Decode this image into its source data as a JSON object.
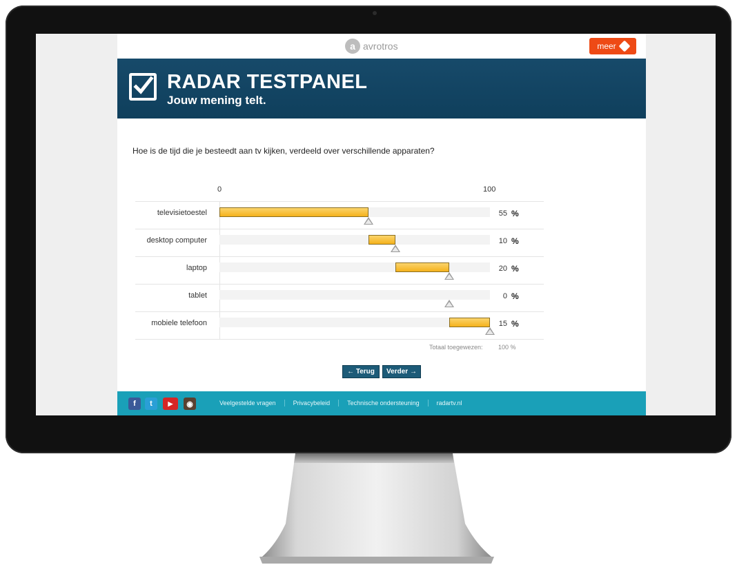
{
  "header": {
    "brand_mark": "a",
    "brand": "avrotros",
    "meer_label": "meer"
  },
  "banner": {
    "title": "RADAR TESTPANEL",
    "subtitle": "Jouw mening telt."
  },
  "question": "Hoe is de tijd die je besteedt aan tv kijken, verdeeld over verschillende apparaten?",
  "scale": {
    "min_label": "0",
    "max_label": "100"
  },
  "rows": [
    {
      "label": "televisietoestel",
      "value": "55",
      "unit": "%"
    },
    {
      "label": "desktop computer",
      "value": "10",
      "unit": "%"
    },
    {
      "label": "laptop",
      "value": "20",
      "unit": "%"
    },
    {
      "label": "tablet",
      "value": "0",
      "unit": "%"
    },
    {
      "label": "mobiele telefoon",
      "value": "15",
      "unit": "%"
    }
  ],
  "total": {
    "label": "Totaal toegewezen:",
    "value": "100 %"
  },
  "buttons": {
    "back": "← Terug",
    "next": "Verder →"
  },
  "footer": {
    "social": [
      "facebook-icon",
      "twitter-icon",
      "youtube-icon",
      "instagram-icon"
    ],
    "social_glyphs": [
      "f",
      "t",
      "▶",
      "◉"
    ],
    "links": [
      "Veelgestelde vragen",
      "Privacybeleid",
      "Technische ondersteuning",
      "radartv.nl"
    ]
  },
  "colors": {
    "banner": "#0f3f5c",
    "meer": "#ee4a15",
    "footer": "#1aa0b8",
    "bar": "#f5b21c"
  }
}
